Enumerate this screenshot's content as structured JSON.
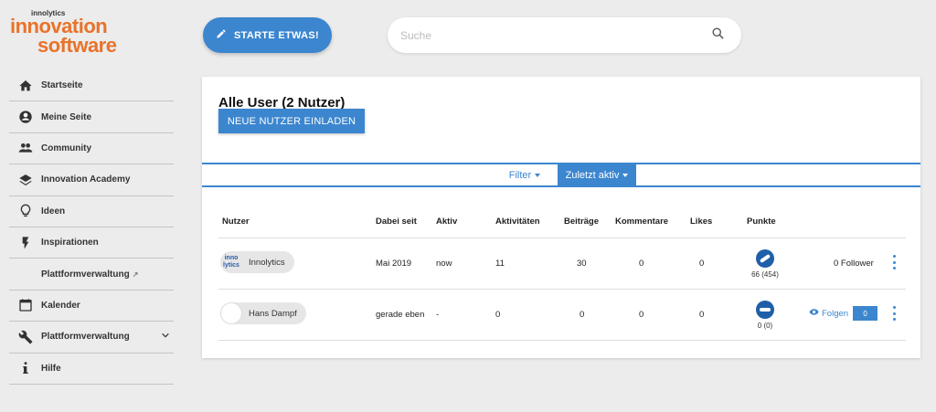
{
  "logo": {
    "brand_small": "innolytics",
    "line1": "innovation",
    "line2": "software"
  },
  "sidebar": {
    "items": [
      {
        "label": "Startseite",
        "icon": "home-icon"
      },
      {
        "label": "Meine Seite",
        "icon": "account-icon"
      },
      {
        "label": "Community",
        "icon": "people-icon"
      },
      {
        "label": "Innovation Academy",
        "icon": "layers-icon"
      },
      {
        "label": "Ideen",
        "icon": "lightbulb-icon"
      },
      {
        "label": "Inspirationen",
        "icon": "bolt-icon"
      },
      {
        "label": "Plattformverwaltung",
        "icon": "external-link-icon"
      },
      {
        "label": "Kalender",
        "icon": "calendar-icon"
      },
      {
        "label": "Plattformverwaltung",
        "icon": "wrench-icon"
      },
      {
        "label": "Hilfe",
        "icon": "info-icon"
      }
    ]
  },
  "topbar": {
    "start_label": "STARTE ETWAS!",
    "search_placeholder": "Suche"
  },
  "main": {
    "title": "Alle User (2 Nutzer)",
    "invite_label": "NEUE NUTZER EINLADEN",
    "filter_label": "Filter",
    "sort_label": "Zuletzt aktiv",
    "columns": [
      "Nutzer",
      "Dabei seit",
      "Aktiv",
      "Aktivitäten",
      "Beiträge",
      "Kommentare",
      "Likes",
      "Punkte"
    ],
    "rows": [
      {
        "name": "Innolytics",
        "avatar_text": "inno lytics",
        "joined": "Mai 2019",
        "active": "now",
        "activities": "11",
        "posts": "30",
        "comments": "0",
        "likes": "0",
        "points": "66 (454)",
        "followers": "0 Follower"
      },
      {
        "name": "Hans Dampf",
        "joined": "gerade eben",
        "active": "-",
        "activities": "0",
        "posts": "0",
        "comments": "0",
        "likes": "0",
        "points": "0 (0)",
        "follow_label": "Folgen",
        "follow_count": "0"
      }
    ]
  },
  "colors": {
    "accent": "#3b86cf",
    "brand_orange": "#e8732a",
    "badge_blue": "#1f5fa8"
  }
}
